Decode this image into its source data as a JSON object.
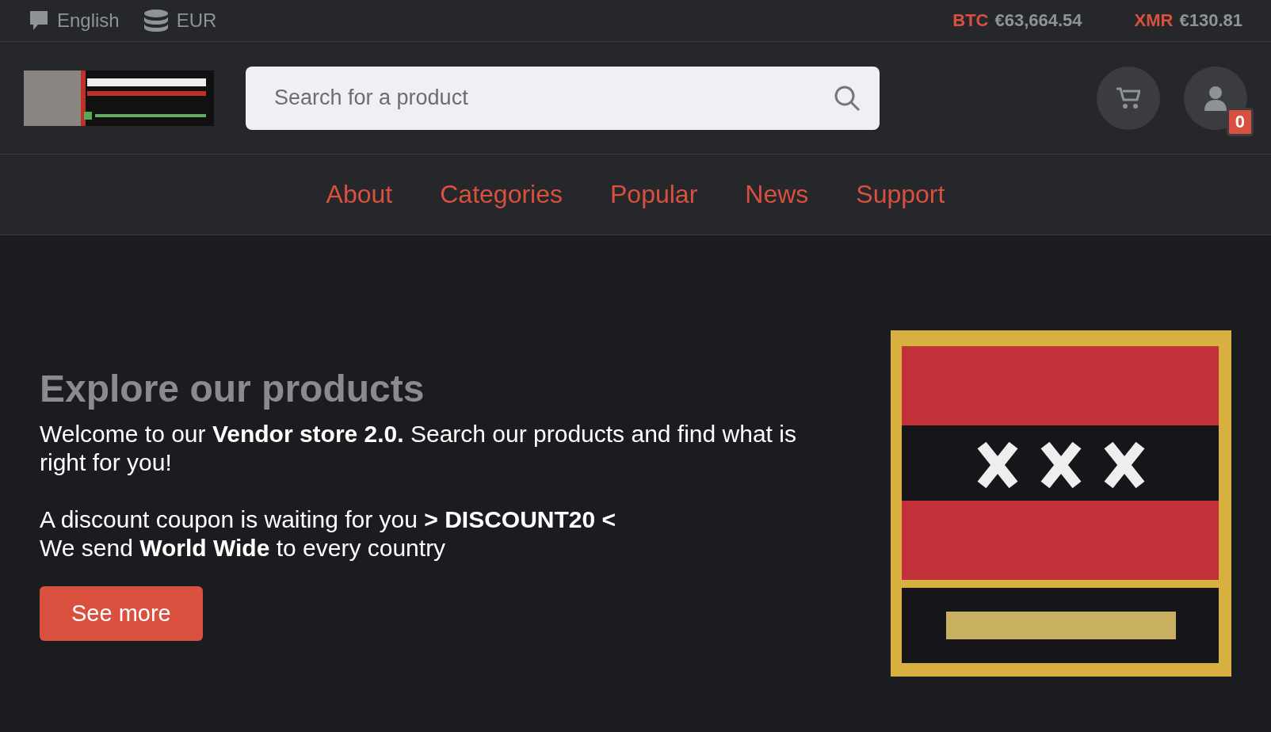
{
  "top_bar": {
    "language": "English",
    "currency": "EUR",
    "rates": [
      {
        "coin": "BTC",
        "price": "€63,664.54"
      },
      {
        "coin": "XMR",
        "price": "€130.81"
      }
    ]
  },
  "header": {
    "search": {
      "placeholder": "Search for a product"
    },
    "account_badge": "0"
  },
  "nav": [
    "About",
    "Categories",
    "Popular",
    "News",
    "Support"
  ],
  "hero": {
    "title": "Explore our products",
    "paragraphs": [
      "Welcome to our **Vendor store 2.0.** Search our products and find what is right for you!",
      "A discount coupon is waiting for you **> DISCOUNT20 <**",
      "We send **World Wide** to every country"
    ],
    "button": "See more"
  }
}
